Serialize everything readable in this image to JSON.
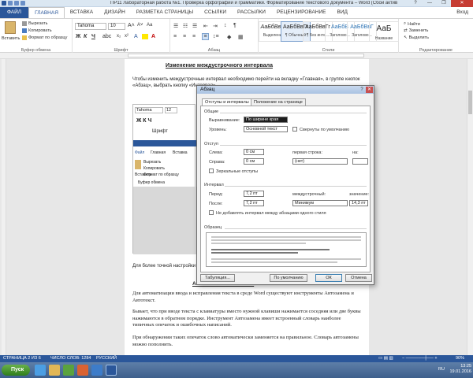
{
  "window": {
    "title": "ПР11 Лабораторная работа №1. Проверка орфографии и грамматики. Форматирование текстового документа – Word (Сбой активации продукта)",
    "min": "—",
    "max": "❐",
    "close": "✕"
  },
  "ribbon_tabs": [
    "ФАЙЛ",
    "ГЛАВНАЯ",
    "ВСТАВКА",
    "ДИЗАЙН",
    "РАЗМЕТКА СТРАНИЦЫ",
    "ССЫЛКИ",
    "РАССЫЛКИ",
    "РЕЦЕНЗИРОВАНИЕ",
    "ВИД"
  ],
  "signin": "Вход",
  "clipboard": {
    "paste": "Вставить",
    "cut": "Вырезать",
    "copy": "Копировать",
    "format_painter": "Формат по образцу",
    "label": "Буфер обмена"
  },
  "font": {
    "name": "Tahoma",
    "size": "10",
    "label": "Шрифт",
    "bold": "Ж",
    "italic": "К",
    "underline": "Ч"
  },
  "paragraph": {
    "label": "Абзац"
  },
  "styles": {
    "label": "Стили",
    "items": [
      {
        "sample": "АаБбВвГг",
        "name": "Выделение"
      },
      {
        "sample": "АаБбВвГг",
        "name": "¶ Обычный"
      },
      {
        "sample": "АаБбВвГг",
        "name": "¶ Без инте..."
      },
      {
        "sample": "АаБбВ",
        "name": "Заголово..."
      },
      {
        "sample": "АаБбВвГ",
        "name": "Заголово..."
      },
      {
        "sample": "АаБ",
        "name": "Название"
      }
    ]
  },
  "editing": {
    "label": "Редактирование",
    "find": "Найти",
    "replace": "Заменить",
    "select": "Выделить"
  },
  "document": {
    "heading": "Изменение междустрочного интервала",
    "intro": "Чтобы изменить междустрочные интервал необходимо перейти на вкладку «Главная», в группе кнопок «Абзац», выбрать кнопку «Интервал».",
    "more": "Для более точной настройки",
    "section2_heading": "Автозамена и Автотекст",
    "p1": "Для автоматизации ввода и исправления текста в среде Word существуют инструменты Автозамена и Автотекст.",
    "p2": "Бывает, что при вводе текста с клавиатуры вместо нужной клавиши нажимается соседняя или две буквы нажимаются в обратном порядке. Инструмент Автозамена имеет встроенный словарь наиболее типичных опечаток и ошибочных написаний.",
    "p3": "При обнаружении таких опечаток слово автоматически заменяется на правильное. Словарь автозамены можно пополнить."
  },
  "embedded": {
    "font": "Tahoma",
    "size": "12",
    "label": "Шрифт",
    "tab_file": "Файл",
    "tab_home": "Главная",
    "tab_insert": "Вставка",
    "paste": "Вставить",
    "cut": "Вырезать",
    "copy": "Копировать",
    "painter": "Формат по образцу",
    "clip": "Буфер обмена"
  },
  "dialog": {
    "title": "Абзац",
    "help": "?",
    "close": "✕",
    "tabs": [
      "Отступы и интервалы",
      "Положение на странице"
    ],
    "general": "Общие",
    "alignment_label": "Выравнивание:",
    "alignment_value": "По ширине края",
    "level_label": "Уровень:",
    "level_value": "Основной текст",
    "collapsed": "Свернуты по умолчанию",
    "indent": "Отступ",
    "left_label": "Слева:",
    "left_value": "0 см",
    "right_label": "Справа:",
    "right_value": "0 см",
    "first_line_label": "первая строка:",
    "first_line_value": "(нет)",
    "on_label": "на:",
    "mirror": "Зеркальные отступы",
    "spacing": "Интервал",
    "before_label": "Перед:",
    "before_value": "7,2 пт",
    "after_label": "После:",
    "after_value": "7,2 пт",
    "line_label": "междустрочный:",
    "line_value": "Минимум",
    "value_label": "значение:",
    "value_value": "14,3 пт",
    "no_space": "Не добавлять интервал между абзацами одного стиля",
    "sample": "Образец",
    "btn_tabs": "Табуляция...",
    "btn_default": "По умолчанию",
    "btn_ok": "ОК",
    "btn_cancel": "Отмена"
  },
  "status": {
    "page": "СТРАНИЦА 2 ИЗ 6",
    "words": "ЧИСЛО СЛОВ: 1284",
    "lang": "РУССКИЙ",
    "zoom": "90%"
  },
  "taskbar": {
    "start": "Пуск",
    "lang": "RU",
    "time": "13:25",
    "date": "19.01.2016"
  }
}
